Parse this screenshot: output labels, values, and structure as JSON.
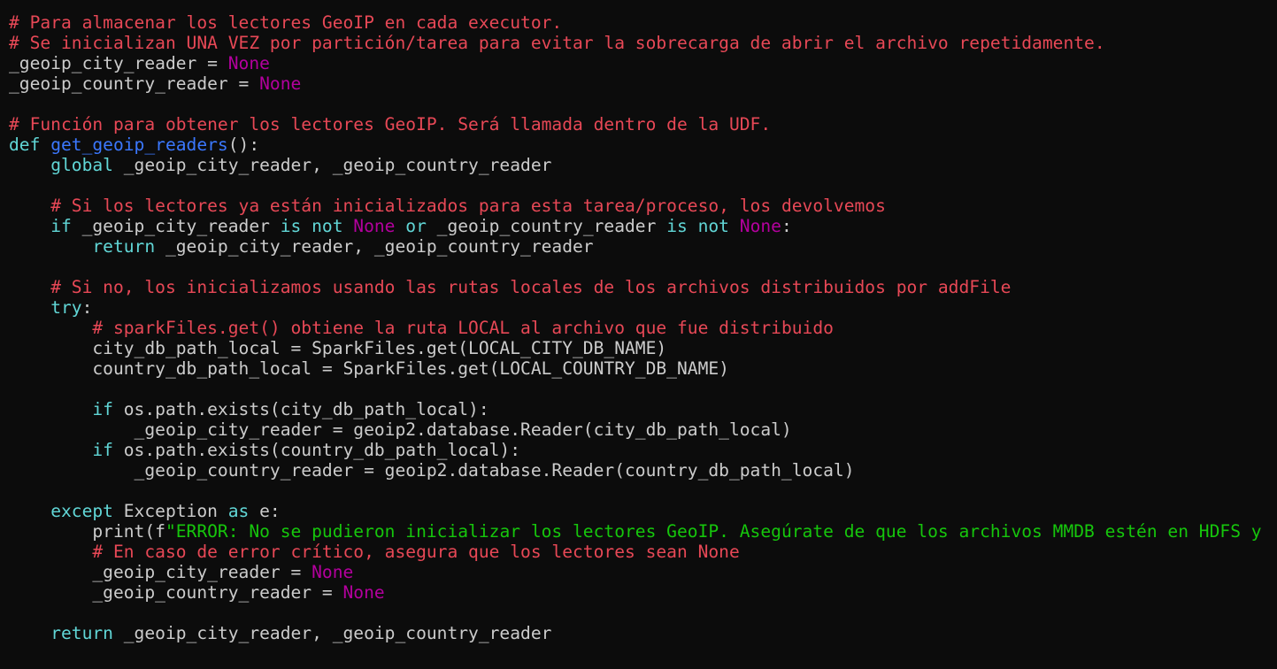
{
  "editor": {
    "colors": {
      "background": "#0c0c0c",
      "default": "#cccccc",
      "comment": "#e74856",
      "keyword": "#61d6d6",
      "constant": "#b4009e",
      "function": "#3b78ff",
      "string": "#16c60c"
    },
    "lines": [
      [
        {
          "t": "# Para almacenar los lectores GeoIP en cada executor.",
          "k": "comment"
        }
      ],
      [
        {
          "t": "# Se inicializan UNA VEZ por partición/tarea para evitar la sobrecarga de abrir el archivo repetidamente.",
          "k": "comment"
        }
      ],
      [
        {
          "t": "_geoip_city_reader = ",
          "k": "default"
        },
        {
          "t": "None",
          "k": "constant"
        }
      ],
      [
        {
          "t": "_geoip_country_reader = ",
          "k": "default"
        },
        {
          "t": "None",
          "k": "constant"
        }
      ],
      [],
      [
        {
          "t": "# Función para obtener los lectores GeoIP. Será llamada dentro de la UDF.",
          "k": "comment"
        }
      ],
      [
        {
          "t": "def ",
          "k": "keyword"
        },
        {
          "t": "get_geoip_readers",
          "k": "function"
        },
        {
          "t": "():",
          "k": "default"
        }
      ],
      [
        {
          "t": "    ",
          "k": "default"
        },
        {
          "t": "global",
          "k": "keyword"
        },
        {
          "t": " _geoip_city_reader, _geoip_country_reader",
          "k": "default"
        }
      ],
      [],
      [
        {
          "t": "    ",
          "k": "default"
        },
        {
          "t": "# Si los lectores ya están inicializados para esta tarea/proceso, los devolvemos",
          "k": "comment"
        }
      ],
      [
        {
          "t": "    ",
          "k": "default"
        },
        {
          "t": "if",
          "k": "keyword"
        },
        {
          "t": " _geoip_city_reader ",
          "k": "default"
        },
        {
          "t": "is",
          "k": "keyword"
        },
        {
          "t": " ",
          "k": "default"
        },
        {
          "t": "not",
          "k": "keyword"
        },
        {
          "t": " ",
          "k": "default"
        },
        {
          "t": "None",
          "k": "constant"
        },
        {
          "t": " ",
          "k": "default"
        },
        {
          "t": "or",
          "k": "keyword"
        },
        {
          "t": " _geoip_country_reader ",
          "k": "default"
        },
        {
          "t": "is",
          "k": "keyword"
        },
        {
          "t": " ",
          "k": "default"
        },
        {
          "t": "not",
          "k": "keyword"
        },
        {
          "t": " ",
          "k": "default"
        },
        {
          "t": "None",
          "k": "constant"
        },
        {
          "t": ":",
          "k": "default"
        }
      ],
      [
        {
          "t": "        ",
          "k": "default"
        },
        {
          "t": "return",
          "k": "keyword"
        },
        {
          "t": " _geoip_city_reader, _geoip_country_reader",
          "k": "default"
        }
      ],
      [],
      [
        {
          "t": "    ",
          "k": "default"
        },
        {
          "t": "# Si no, los inicializamos usando las rutas locales de los archivos distribuidos por addFile",
          "k": "comment"
        }
      ],
      [
        {
          "t": "    ",
          "k": "default"
        },
        {
          "t": "try",
          "k": "keyword"
        },
        {
          "t": ":",
          "k": "default"
        }
      ],
      [
        {
          "t": "        ",
          "k": "default"
        },
        {
          "t": "# sparkFiles.get() obtiene la ruta LOCAL al archivo que fue distribuido",
          "k": "comment"
        }
      ],
      [
        {
          "t": "        city_db_path_local = SparkFiles.get(LOCAL_CITY_DB_NAME)",
          "k": "default"
        }
      ],
      [
        {
          "t": "        country_db_path_local = SparkFiles.get(LOCAL_COUNTRY_DB_NAME)",
          "k": "default"
        }
      ],
      [],
      [
        {
          "t": "        ",
          "k": "default"
        },
        {
          "t": "if",
          "k": "keyword"
        },
        {
          "t": " os.path.exists(city_db_path_local):",
          "k": "default"
        }
      ],
      [
        {
          "t": "            _geoip_city_reader = geoip2.database.Reader(city_db_path_local)",
          "k": "default"
        }
      ],
      [
        {
          "t": "        ",
          "k": "default"
        },
        {
          "t": "if",
          "k": "keyword"
        },
        {
          "t": " os.path.exists(country_db_path_local):",
          "k": "default"
        }
      ],
      [
        {
          "t": "            _geoip_country_reader = geoip2.database.Reader(country_db_path_local)",
          "k": "default"
        }
      ],
      [],
      [
        {
          "t": "    ",
          "k": "default"
        },
        {
          "t": "except",
          "k": "keyword"
        },
        {
          "t": " Exception ",
          "k": "default"
        },
        {
          "t": "as",
          "k": "keyword"
        },
        {
          "t": " e:",
          "k": "default"
        }
      ],
      [
        {
          "t": "        print(f",
          "k": "default"
        },
        {
          "t": "\"ERROR: No se pudieron inicializar los lectores GeoIP. Asegúrate de que los archivos MMDB estén en HDFS y",
          "k": "string"
        }
      ],
      [
        {
          "t": "        ",
          "k": "default"
        },
        {
          "t": "# En caso de error crítico, asegura que los lectores sean None",
          "k": "comment"
        }
      ],
      [
        {
          "t": "        _geoip_city_reader = ",
          "k": "default"
        },
        {
          "t": "None",
          "k": "constant"
        }
      ],
      [
        {
          "t": "        _geoip_country_reader = ",
          "k": "default"
        },
        {
          "t": "None",
          "k": "constant"
        }
      ],
      [],
      [
        {
          "t": "    ",
          "k": "default"
        },
        {
          "t": "return",
          "k": "keyword"
        },
        {
          "t": " _geoip_city_reader, _geoip_country_reader",
          "k": "default"
        }
      ]
    ]
  }
}
